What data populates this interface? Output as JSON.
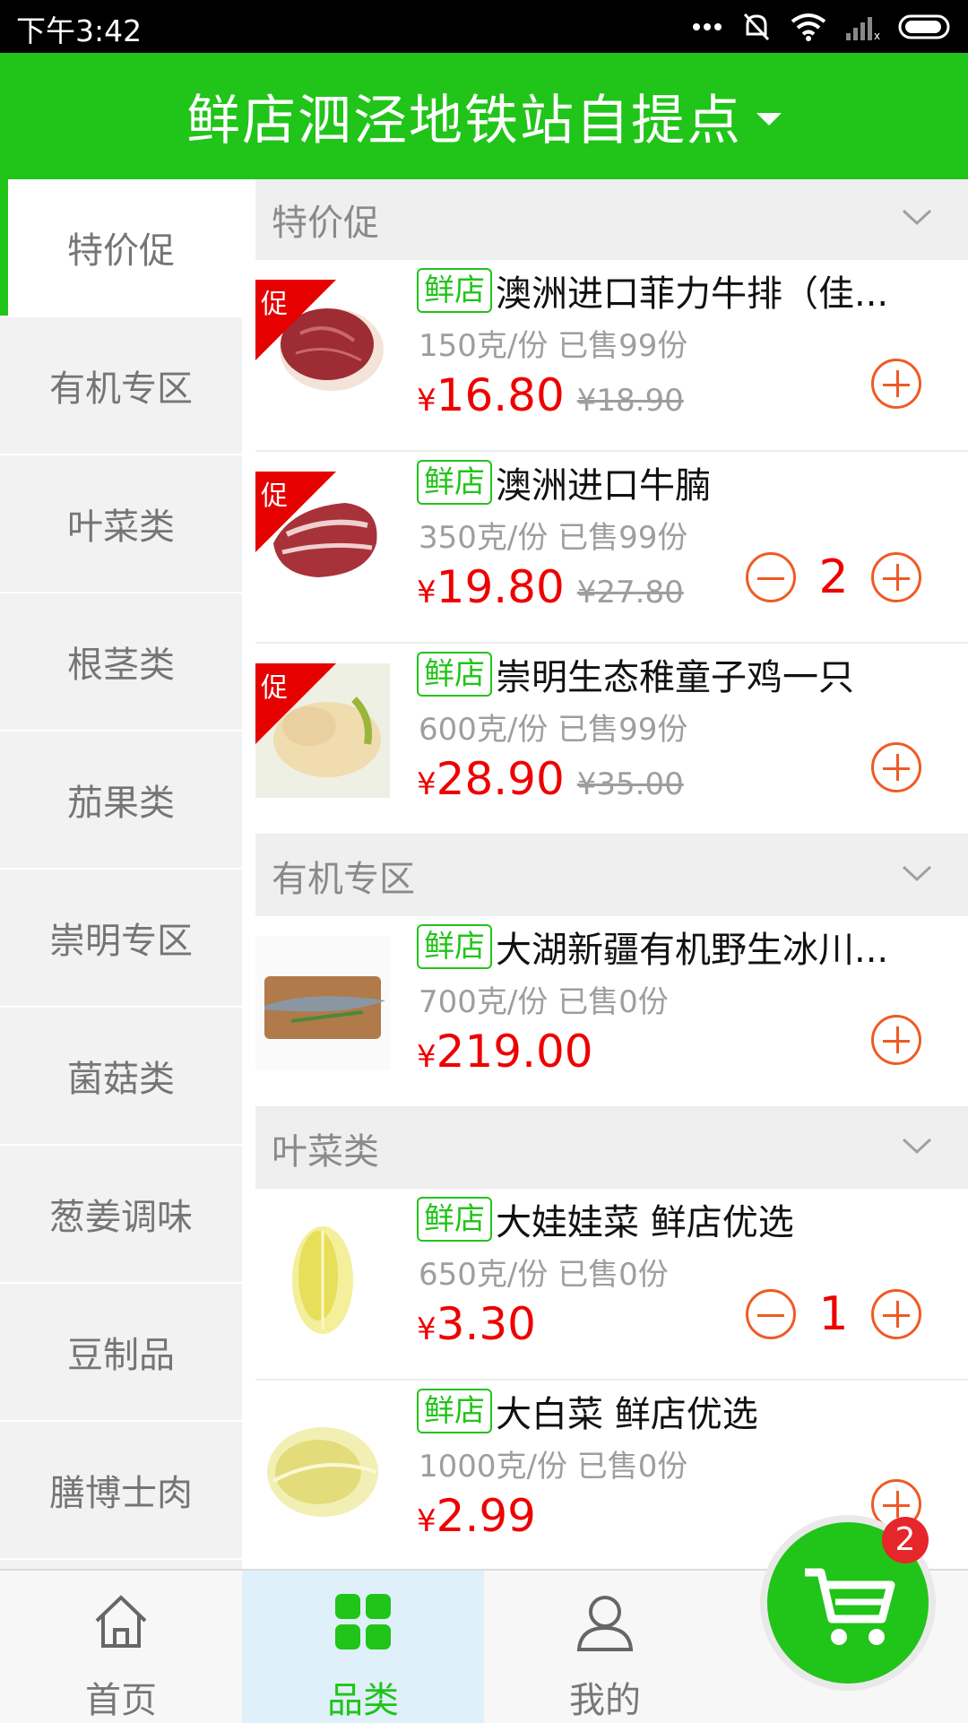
{
  "status_bar": {
    "time": "下午3:42"
  },
  "header": {
    "title": "鲜店泗泾地铁站自提点"
  },
  "sidebar": {
    "items": [
      {
        "label": "特价促"
      },
      {
        "label": "有机专区"
      },
      {
        "label": "叶菜类"
      },
      {
        "label": "根茎类"
      },
      {
        "label": "茄果类"
      },
      {
        "label": "崇明专区"
      },
      {
        "label": "菌菇类"
      },
      {
        "label": "葱姜调味"
      },
      {
        "label": "豆制品"
      },
      {
        "label": "膳博士肉"
      }
    ]
  },
  "shop_tag": "鲜店",
  "promo_label": "促",
  "currency": "¥",
  "sections": [
    {
      "title": "特价促",
      "products": [
        {
          "name": "澳洲进口菲力牛排（佳...",
          "spec": "150克/份  已售99份",
          "price": "16.80",
          "old_price": "¥18.90",
          "qty": ""
        },
        {
          "name": "澳洲进口牛腩",
          "spec": "350克/份  已售99份",
          "price": "19.80",
          "old_price": "¥27.80",
          "qty": "2"
        },
        {
          "name": "崇明生态稚童子鸡一只",
          "spec": "600克/份  已售99份",
          "price": "28.90",
          "old_price": "¥35.00",
          "qty": ""
        }
      ]
    },
    {
      "title": "有机专区",
      "products": [
        {
          "name": "大湖新疆有机野生冰川...",
          "spec": "700克/份  已售0份",
          "price": "219.00",
          "old_price": "",
          "qty": ""
        }
      ]
    },
    {
      "title": "叶菜类",
      "products": [
        {
          "name": "大娃娃菜 鲜店优选",
          "spec": "650克/份  已售0份",
          "price": "3.30",
          "old_price": "",
          "qty": "1"
        },
        {
          "name": "大白菜 鲜店优选",
          "spec": "1000克/份  已售0份",
          "price": "2.99",
          "old_price": "",
          "qty": ""
        }
      ]
    }
  ],
  "bottom_nav": {
    "home": "首页",
    "category": "品类",
    "mine": "我的"
  },
  "cart": {
    "count": "2"
  },
  "colors": {
    "brand_green": "#21c419",
    "price_red": "#ee0000",
    "action_orange": "#f05a22"
  }
}
